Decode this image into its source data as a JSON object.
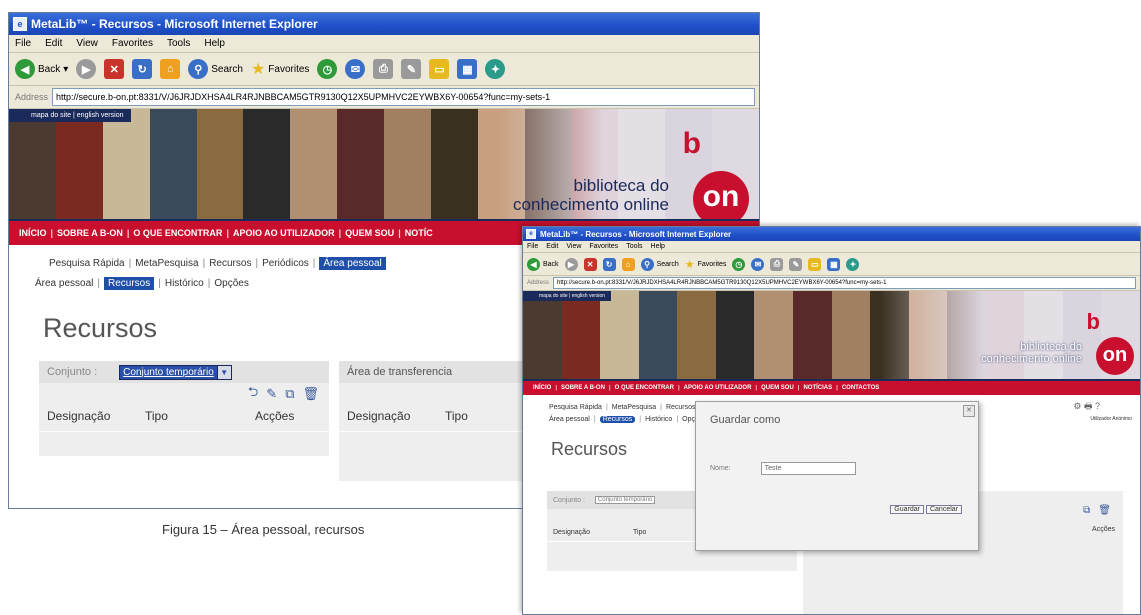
{
  "browser": {
    "title": "MetaLib™ - Recursos - Microsoft Internet Explorer",
    "menus": [
      "File",
      "Edit",
      "View",
      "Favorites",
      "Tools",
      "Help"
    ],
    "back_label": "Back",
    "search_label": "Search",
    "favorites_label": "Favorites",
    "address_label": "Address",
    "url_main": "http://secure.b-on.pt:8331/V/J6JRJDXHSA4LR4RJNBBCAM5GTR9130Q12X5UPMHVC2EYWBX6Y-00654?func=my-sets-1",
    "url_dialog": "http://secure.b-on.pt:8331/V/J6JRJDXHSA4LR4RJNBBCAM5GTR9130Q12X5UPMHVC2EYWBX6Y-00654?func=my-sets-1"
  },
  "banner": {
    "top_links": "mapa do site | english version",
    "brand_b": "b",
    "brand_text_1": "biblioteca do",
    "brand_text_2": "conhecimento online",
    "brand_on": "on"
  },
  "nav_main": [
    "INÍCIO",
    "SOBRE A B-ON",
    "O QUE ENCONTRAR",
    "APOIO AO UTILIZADOR",
    "QUEM SOU",
    "NOTÍC"
  ],
  "nav_dialog": [
    "INÍCIO",
    "SOBRE A B-ON",
    "O QUE ENCONTRAR",
    "APOIO AO UTILIZADOR",
    "QUEM SOU",
    "NOTÍCIAS",
    "CONTACTOS"
  ],
  "submenu": {
    "row1": [
      "Pesquisa Rápida",
      "MetaPesquisa",
      "Recursos",
      "Periódicos",
      "Área pessoal"
    ],
    "row2": [
      "Área pessoal",
      "Recursos",
      "Histórico",
      "Opções"
    ]
  },
  "page": {
    "title": "Recursos",
    "conjunto_label": "Conjunto :",
    "conjunto_value": "Conjunto temporário",
    "transfer_area": "Área de transferencia",
    "col_designacao": "Designação",
    "col_tipo": "Tipo",
    "col_accoes": "Acções"
  },
  "dialog": {
    "title": "Guardar como",
    "field_label": "Nome:",
    "field_value": "Teste",
    "save_button": "Guardar",
    "cancel_button": "Cancelar",
    "conjunto_label": "Conjunto :",
    "conjunto_value": "Conjunto temporário",
    "col_designacao": "Designação",
    "col_tipo": "Tipo",
    "col_accoes": "Acções",
    "user_name": "Utilizador Anónimo",
    "utility_icons": "⚙ 🖶 ?"
  },
  "caption": "Figura 15 – Área pessoal, recursos",
  "colors": {
    "titlebar": "#1f4fc8",
    "nav_red": "#c8102e",
    "active_blue": "#1f4fa8",
    "navy": "#1a2a5a"
  }
}
